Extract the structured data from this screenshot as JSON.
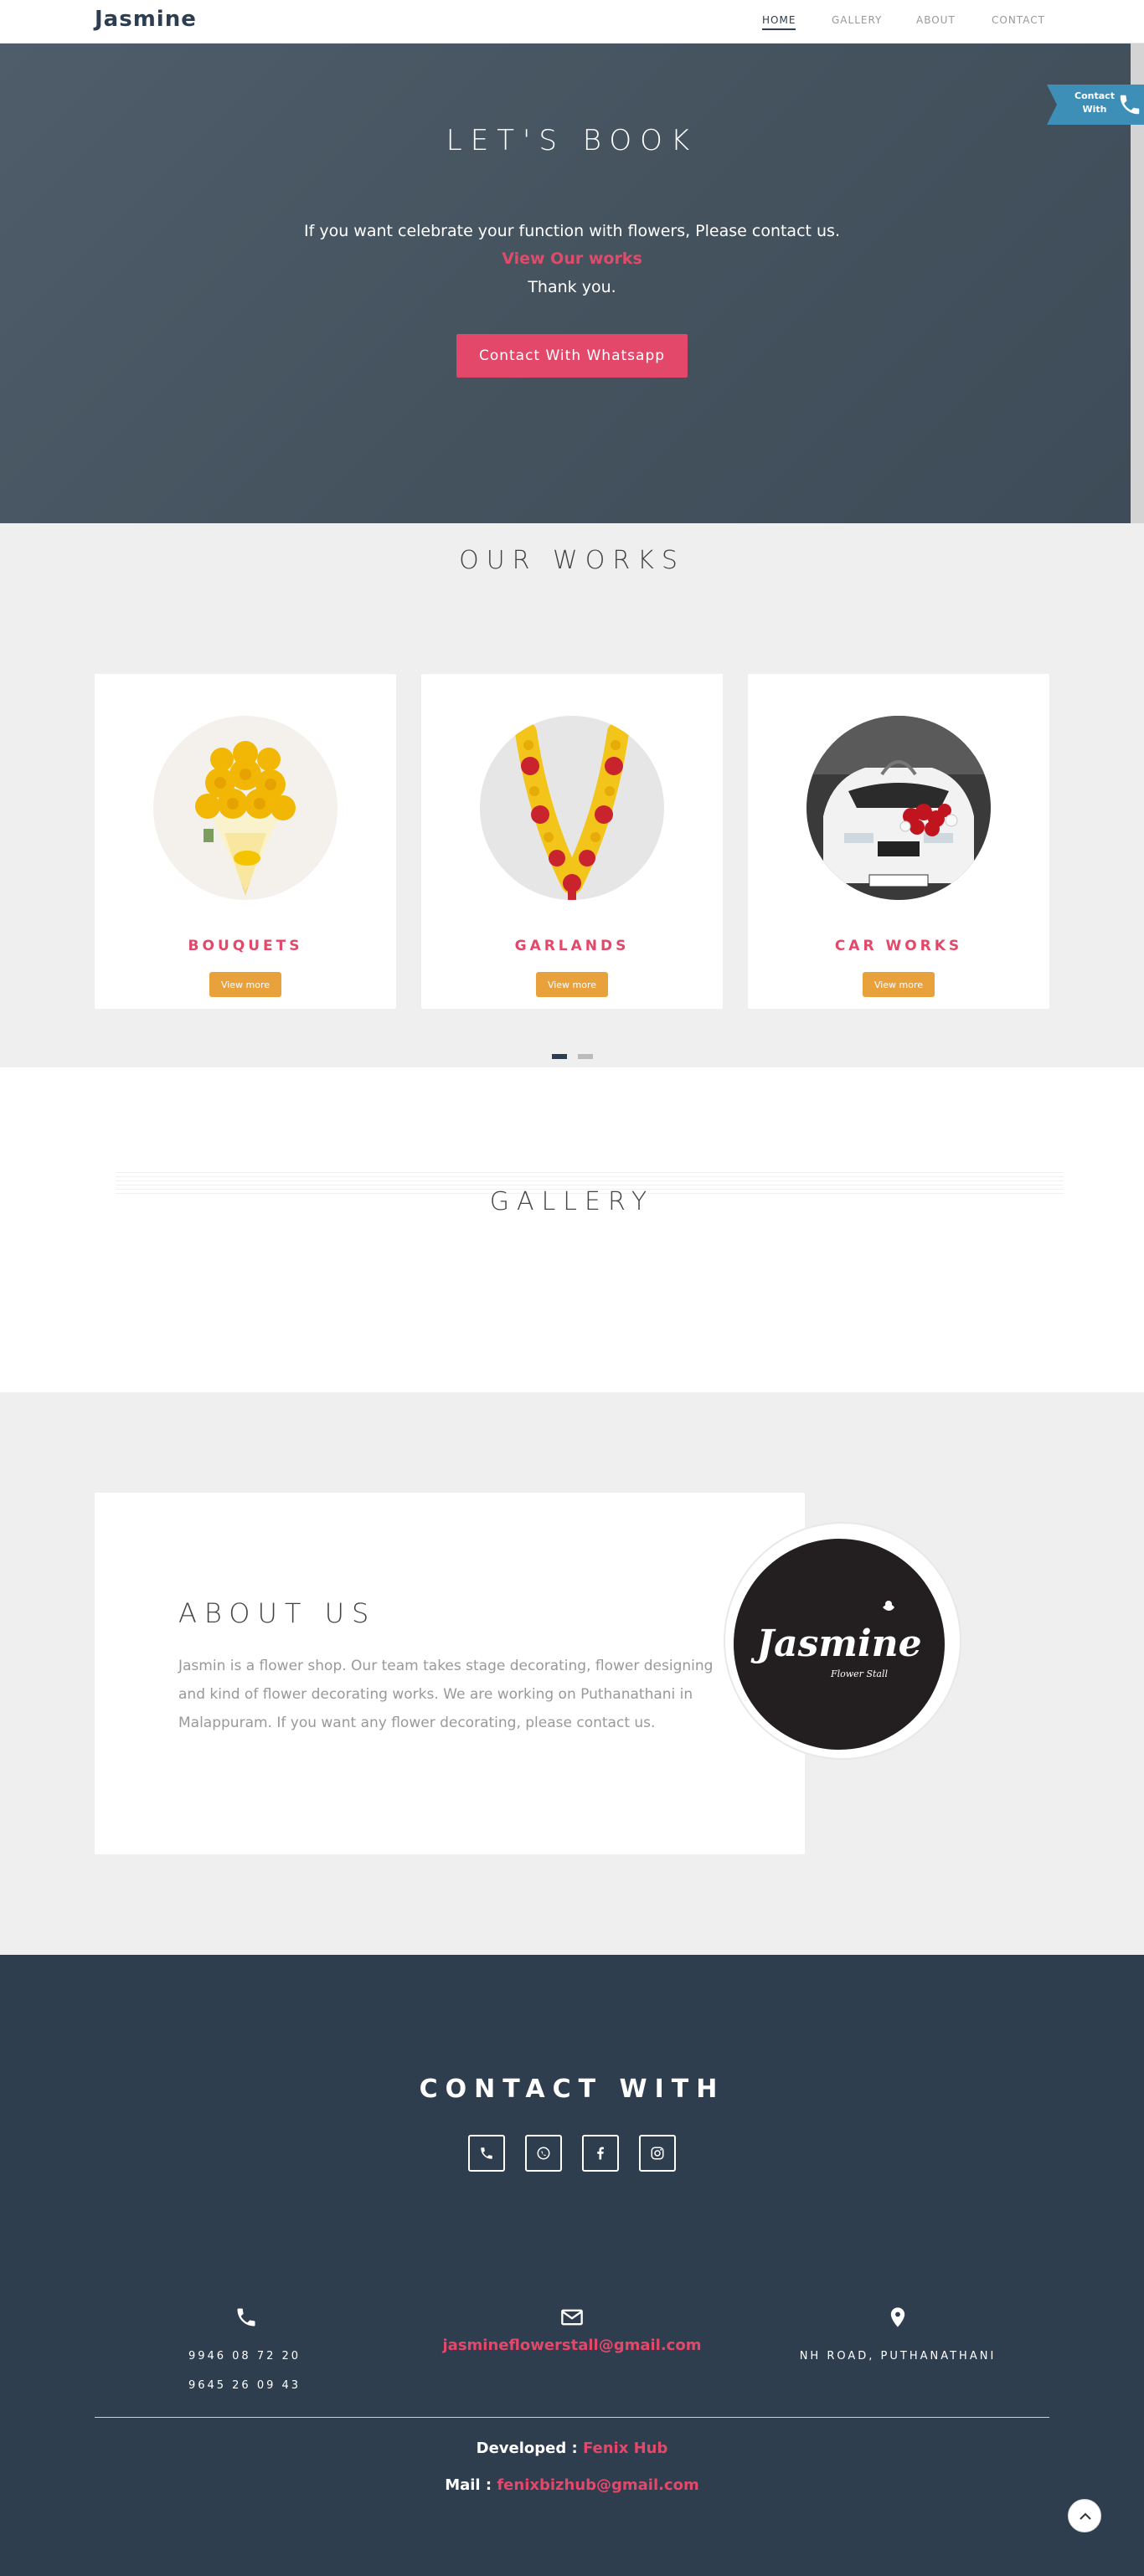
{
  "nav": {
    "brand": "Jasmine",
    "links": [
      {
        "label": "HOME",
        "active": true
      },
      {
        "label": "GALLERY",
        "active": false
      },
      {
        "label": "ABOUT",
        "active": false
      },
      {
        "label": "CONTACT",
        "active": false
      }
    ]
  },
  "hero": {
    "title": "LET'S BOOK",
    "line1": "If you want celebrate your function with flowers, Please contact us.",
    "link": "View Our works",
    "line3": "Thank you.",
    "button": "Contact With Whatsapp",
    "contact_tab": "Contact With"
  },
  "works": {
    "title": "OUR WORKS",
    "cards": [
      {
        "title": "BOUQUETS",
        "button": "View more"
      },
      {
        "title": "GARLANDS",
        "button": "View more"
      },
      {
        "title": "CAR WORKS",
        "button": "View more"
      }
    ]
  },
  "gallery": {
    "title": "GALLERY"
  },
  "about": {
    "title": "ABOUT US",
    "text": "Jasmin is a flower shop. Our team takes stage decorating, flower designing and kind of flower decorating works. We are working on Puthanathani in Malappuram. If you want any flower decorating, please contact us.",
    "logo_text": "Jasmine",
    "logo_sub": "Flower Stall"
  },
  "contact": {
    "title": "CONTACT WITH",
    "phone1": "9946 08 72 20",
    "phone2": "9645 26 09 43",
    "email": "jasmineflowerstall@gmail.com",
    "address": "NH ROAD, PUTHANATHANI",
    "dev_label": "Developed : ",
    "dev_name": "Fenix Hub",
    "mail_label": "Mail : ",
    "mail_value": "fenixbizhub@gmail.com"
  },
  "colors": {
    "accent": "#e3486a",
    "dark": "#2e3e4f",
    "button_orange": "#e9a23b"
  }
}
